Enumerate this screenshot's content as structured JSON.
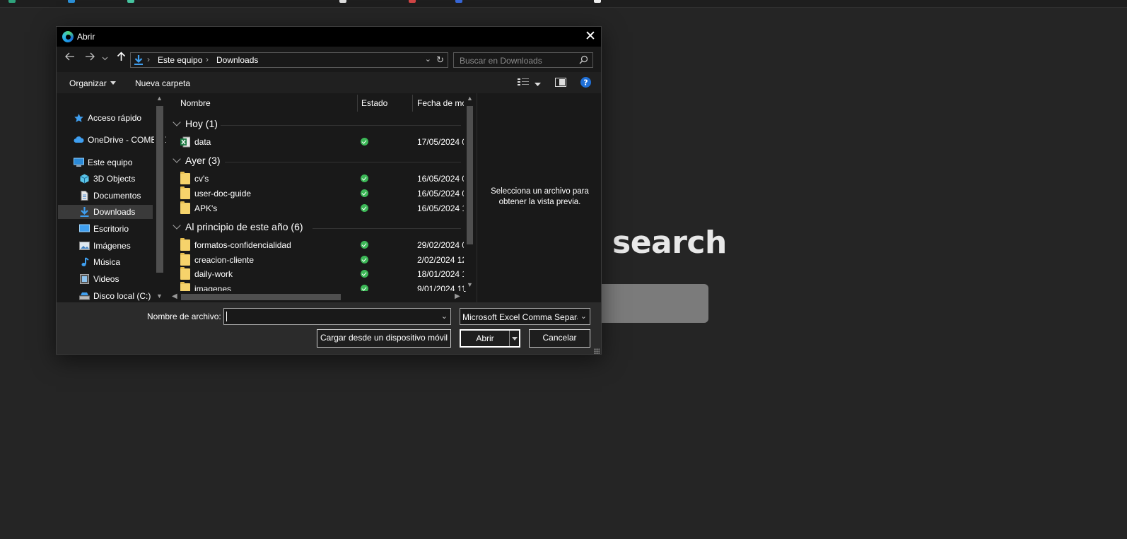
{
  "page": {
    "heading": "search"
  },
  "dialog": {
    "title": "Abrir",
    "close_glyph": "✕",
    "nav": {
      "back_icon": "arrow-left-icon",
      "forward_icon": "arrow-right-icon",
      "recent_icon": "chevron-down-icon",
      "up_icon": "arrow-up-icon"
    },
    "address": {
      "crumbs": [
        "Este equipo",
        "Downloads"
      ]
    },
    "search": {
      "placeholder": "Buscar en Downloads"
    },
    "toolbar": {
      "organize_label": "Organizar",
      "new_folder_label": "Nueva carpeta",
      "help_glyph": "?"
    },
    "sidebar": {
      "items": [
        {
          "label": "Acceso rápido",
          "icon": "star-icon"
        },
        {
          "label": "OneDrive - COMERCIALIZADORA",
          "icon": "cloud-icon"
        },
        {
          "label": "Este equipo",
          "icon": "computer-icon"
        },
        {
          "label": "3D Objects",
          "icon": "cube-icon"
        },
        {
          "label": "Documentos",
          "icon": "document-icon"
        },
        {
          "label": "Downloads",
          "icon": "download-icon",
          "selected": true
        },
        {
          "label": "Escritorio",
          "icon": "desktop-icon"
        },
        {
          "label": "Imágenes",
          "icon": "image-icon"
        },
        {
          "label": "Música",
          "icon": "music-note-icon"
        },
        {
          "label": "Videos",
          "icon": "film-icon"
        },
        {
          "label": "Disco local (C:)",
          "icon": "drive-icon"
        }
      ]
    },
    "columns": [
      "Nombre",
      "Estado",
      "Fecha de modificación"
    ],
    "groups": [
      {
        "label": "Hoy (1)",
        "files": [
          {
            "name": "data",
            "type": "excel",
            "status": "synced",
            "date": "17/05/2024 0"
          }
        ]
      },
      {
        "label": "Ayer (3)",
        "files": [
          {
            "name": "cv's",
            "type": "folder",
            "status": "synced",
            "date": "16/05/2024 0"
          },
          {
            "name": "user-doc-guide",
            "type": "folder",
            "status": "synced",
            "date": "16/05/2024 0"
          },
          {
            "name": "APK's",
            "type": "folder",
            "status": "synced",
            "date": "16/05/2024 1"
          }
        ]
      },
      {
        "label": "Al principio de este año (6)",
        "files": [
          {
            "name": "formatos-confidencialidad",
            "type": "folder",
            "status": "synced",
            "date": "29/02/2024 0"
          },
          {
            "name": "creacion-cliente",
            "type": "folder",
            "status": "synced",
            "date": "2/02/2024 12"
          },
          {
            "name": "daily-work",
            "type": "folder",
            "status": "synced",
            "date": "18/01/2024 1"
          },
          {
            "name": "imagenes",
            "type": "folder",
            "status": "synced",
            "date": "9/01/2024 11"
          }
        ]
      }
    ],
    "preview": {
      "message": "Selecciona un archivo para obtener la vista previa."
    },
    "filename": {
      "label": "Nombre de archivo:",
      "value": ""
    },
    "filetype": {
      "value": "Microsoft Excel Comma Separated Values File (*.csv)"
    },
    "buttons": {
      "mobile": "Cargar desde un dispositivo móvil",
      "open": "Abrir",
      "cancel": "Cancelar"
    }
  },
  "colors": {
    "background": "#252525",
    "dialog": "#191919",
    "titlebar": "#000000",
    "status_synced": "#3cb857",
    "folder": "#f6d36b"
  }
}
